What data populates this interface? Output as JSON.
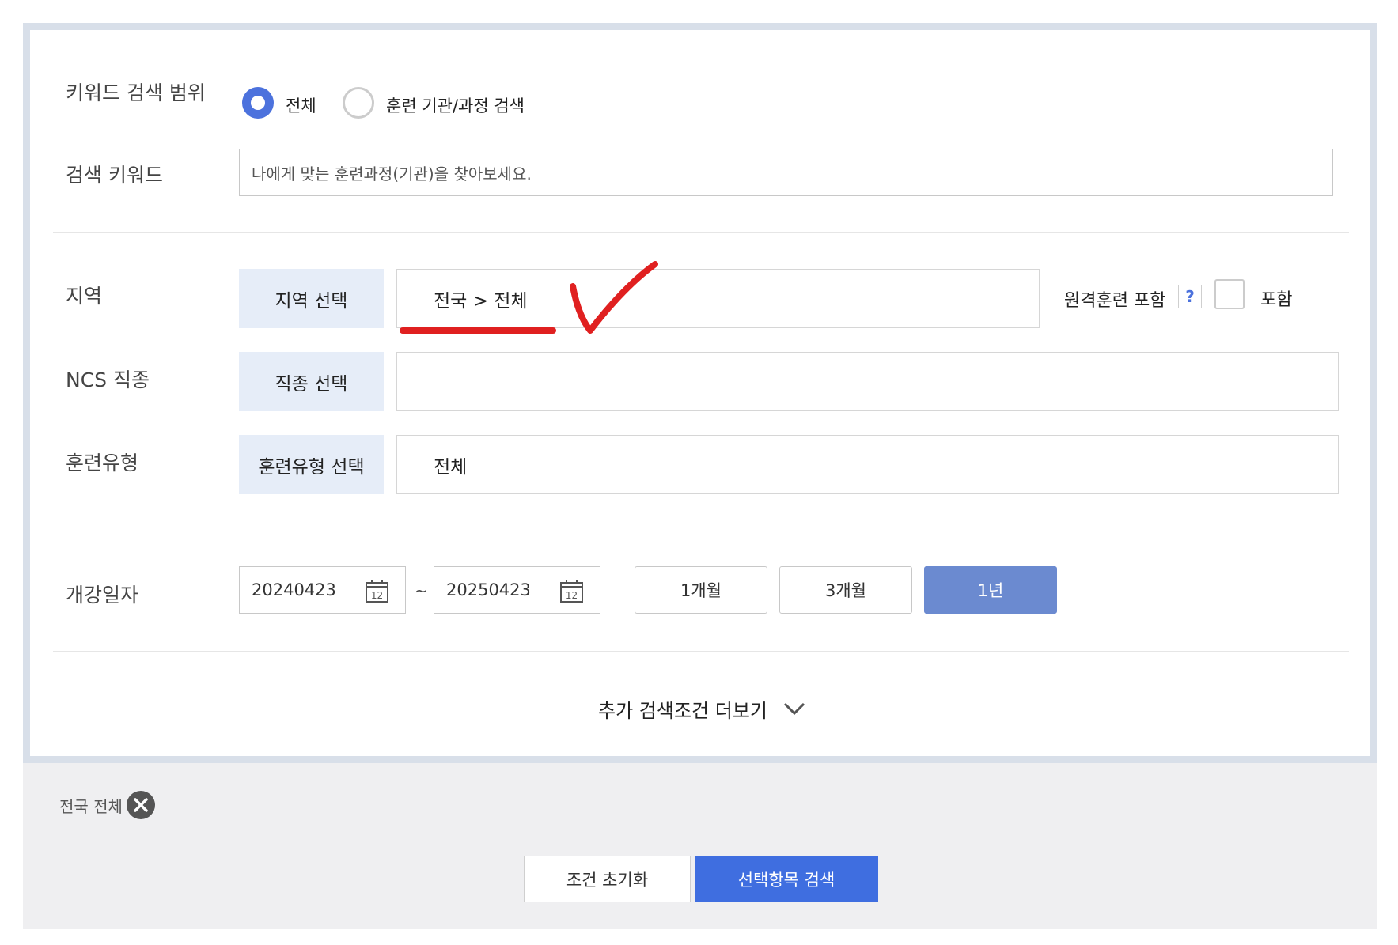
{
  "keyword_scope": {
    "label": "키워드 검색 범위",
    "options": [
      {
        "label": "전체",
        "checked": true
      },
      {
        "label": "훈련 기관/과정 검색",
        "checked": false
      }
    ]
  },
  "keyword": {
    "label": "검색 키워드",
    "placeholder": "나에게 맞는 훈련과정(기관)을 찾아보세요.",
    "value": ""
  },
  "region": {
    "label": "지역",
    "button": "지역 선택",
    "value": "전국 > 전체",
    "remote_label": "원격훈련 포함",
    "help": "?",
    "include_label": "포함",
    "include_checked": false
  },
  "ncs": {
    "label": "NCS 직종",
    "button": "직종 선택",
    "value": ""
  },
  "training_type": {
    "label": "훈련유형",
    "button": "훈련유형 선택",
    "value": "전체"
  },
  "start_date": {
    "label": "개강일자",
    "from": "20240423",
    "separator": "~",
    "to": "20250423",
    "calendar_icon_text": "12",
    "periods": [
      {
        "label": "1개월",
        "active": false
      },
      {
        "label": "3개월",
        "active": false
      },
      {
        "label": "1년",
        "active": true
      }
    ]
  },
  "more_conditions": {
    "label": "추가 검색조건 더보기",
    "icon": "chevron-down-icon"
  },
  "selected_chips": [
    {
      "label": "전국 전체",
      "icon": "close-circle-icon"
    }
  ],
  "actions": {
    "reset": "조건 초기화",
    "search": "선택항목 검색"
  },
  "colors": {
    "accent": "#4c72dd",
    "primary_button": "#3f6ee0",
    "active_period": "#6b8ad0",
    "select_button_bg": "#e6edf8",
    "card_border": "#d8dfe9",
    "annotation_red": "#e02020"
  }
}
